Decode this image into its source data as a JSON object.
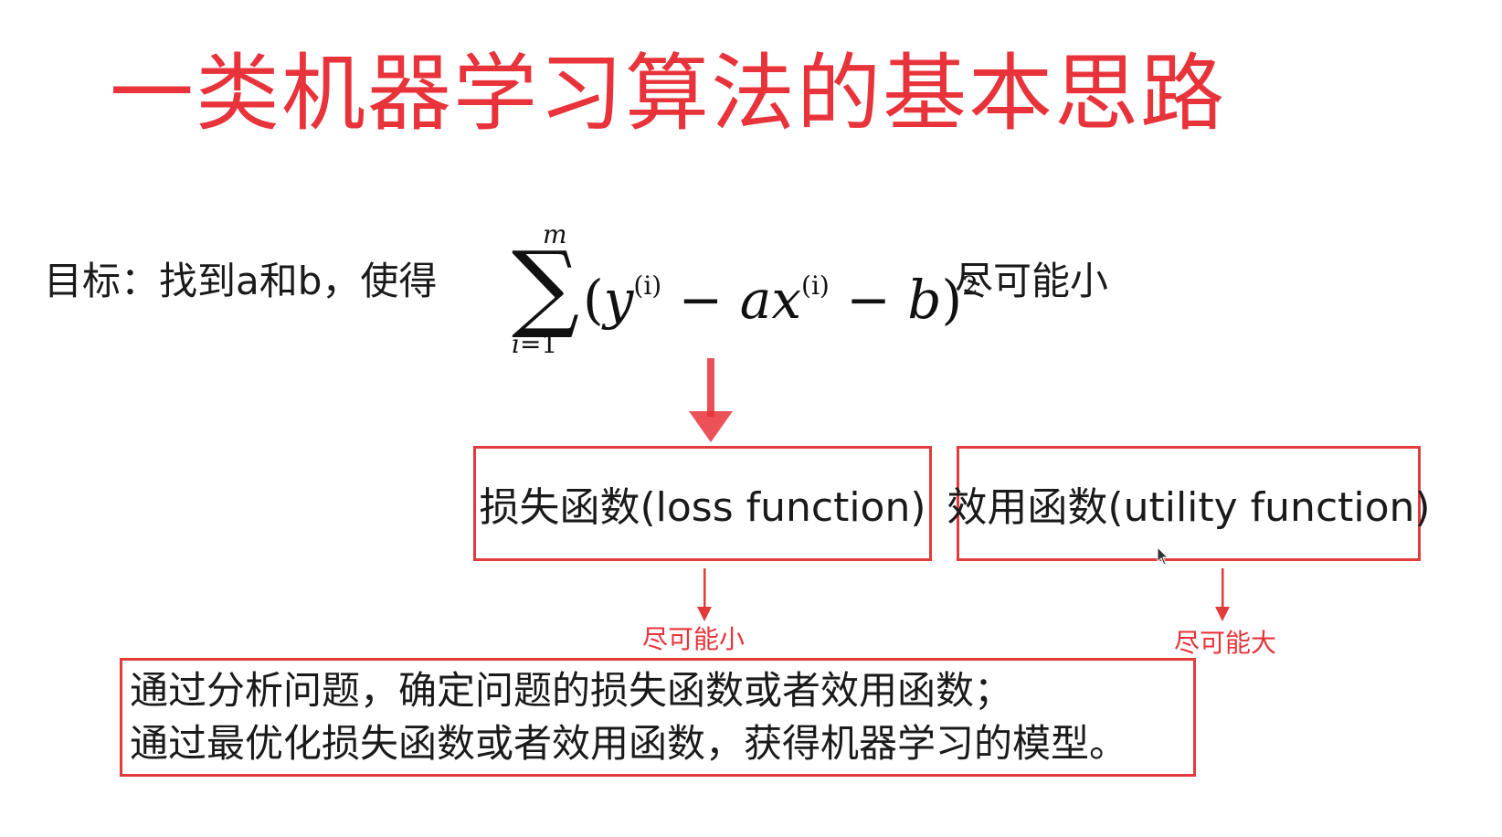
{
  "title": "一类机器学习算法的基本思路",
  "goal": {
    "label": "目标：找到a和b，使得",
    "after_formula": "尽可能小",
    "formula": {
      "upper_limit": "m",
      "lower_index": "i",
      "lower_eq": "=1",
      "sigma": "∑",
      "open_paren": "(",
      "y": "y",
      "sup_i": "(i)",
      "minus1": " − ",
      "a": "a",
      "x": "x",
      "minus2": " − ",
      "b": "b",
      "close_paren": ")",
      "power": "2"
    }
  },
  "boxes": {
    "loss": "损失函数(loss function)",
    "utility": "效用函数(utility function)"
  },
  "notes": {
    "loss": "尽可能小",
    "utility": "尽可能大"
  },
  "summary": {
    "line1": "通过分析问题，确定问题的损失函数或者效用函数；",
    "line2": "通过最优化损失函数或者效用函数，获得机器学习的模型。"
  },
  "colors": {
    "accent": "#e8333a",
    "box_border": "#e23b3b"
  }
}
